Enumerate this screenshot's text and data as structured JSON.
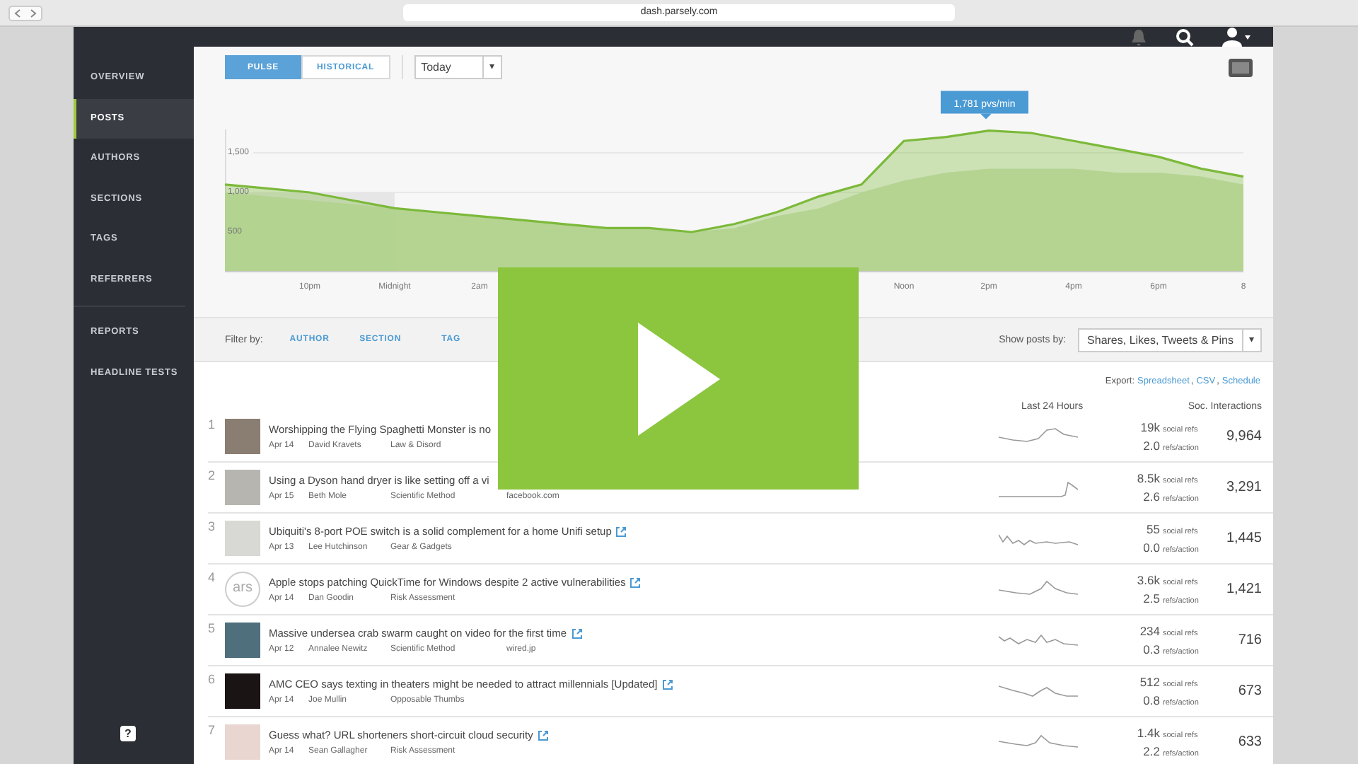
{
  "browser": {
    "url": "dash.parsely.com"
  },
  "sidebar": {
    "groups": [
      {
        "items": [
          {
            "label": "OVERVIEW",
            "selected": false
          },
          {
            "label": "POSTS",
            "selected": true
          },
          {
            "label": "AUTHORS",
            "selected": false
          },
          {
            "label": "SECTIONS",
            "selected": false
          },
          {
            "label": "TAGS",
            "selected": false
          },
          {
            "label": "REFERRERS",
            "selected": false
          }
        ]
      },
      {
        "items": [
          {
            "label": "REPORTS",
            "selected": false
          },
          {
            "label": "HEADLINE TESTS",
            "selected": false
          }
        ]
      }
    ],
    "help": "?"
  },
  "toolbar": {
    "modes": [
      {
        "label": "PULSE",
        "selected": true
      },
      {
        "label": "HISTORICAL",
        "selected": false
      }
    ],
    "period": "Today",
    "caret": "▾"
  },
  "chart": {
    "chart_data": {
      "type": "area",
      "categories": [
        null,
        null,
        "10pm",
        null,
        "Midnight",
        null,
        "2am",
        null,
        null,
        null,
        null,
        null,
        null,
        null,
        null,
        null,
        "Noon",
        null,
        "2pm",
        null,
        "4pm",
        null,
        "6pm",
        null,
        "8"
      ],
      "series": [
        {
          "color": "#7cb93a",
          "values": [
            1100,
            1050,
            1000,
            900,
            800,
            750,
            700,
            650,
            600,
            550,
            550,
            500,
            600,
            750,
            950,
            1100,
            1650,
            1700,
            1781,
            1750,
            1650,
            1550,
            1450,
            1300,
            1200
          ]
        },
        {
          "color": "#cfdfbb",
          "values": [
            1000,
            950,
            900,
            850,
            800,
            750,
            700,
            650,
            600,
            550,
            550,
            500,
            550,
            700,
            800,
            1000,
            1150,
            1250,
            1300,
            1300,
            1300,
            1250,
            1250,
            1200,
            1100
          ]
        }
      ],
      "ylim": [
        0,
        1800
      ],
      "yticks": [
        {
          "value": 500,
          "label": "500"
        },
        {
          "value": 1000,
          "label": "1,000"
        },
        {
          "value": 1500,
          "label": "1,500"
        }
      ],
      "annotations": [
        "1,781 pvs/min"
      ]
    }
  },
  "filter": {
    "label": "Filter by:",
    "options": [
      "AUTHOR",
      "SECTION",
      "TAG"
    ],
    "show_label": "Show posts by:",
    "show_value": "Shares, Likes, Tweets & Pins",
    "caret": "▾"
  },
  "export": {
    "label": "Export:",
    "items": [
      {
        "kind": "link",
        "text": "Spreadsheet"
      },
      {
        "kind": "sep",
        "text": ","
      },
      {
        "kind": "link",
        "text": "CSV"
      },
      {
        "kind": "sep",
        "text": ","
      },
      {
        "kind": "link",
        "text": "Schedule"
      }
    ]
  },
  "table": {
    "columns": [
      "Last 24 Hours",
      "Soc. Interactions"
    ],
    "rows": [
      {
        "rank": "1",
        "thumb": {
          "kind": "photo"
        },
        "title": "Worshipping the Flying Spaghetti Monster is no",
        "link": false,
        "date": "Apr 14",
        "author": "David Kravets",
        "section": "Law & Disord",
        "refs": "19k",
        "refs_label": "social refs",
        "ratio": "2.0",
        "ratio_label": "refs/action",
        "interactions": "9,964"
      },
      {
        "rank": "2",
        "thumb": {
          "kind": "photo"
        },
        "title": "Using a Dyson hand dryer is like setting off a vi",
        "link": false,
        "date": "Apr 15",
        "author": "Beth Mole",
        "section": "Scientific Method",
        "referrer": "facebook.com",
        "refs": "8.5k",
        "refs_label": "social refs",
        "ratio": "2.6",
        "ratio_label": "refs/action",
        "interactions": "3,291"
      },
      {
        "rank": "3",
        "thumb": {
          "kind": "photo"
        },
        "title": "Ubiquiti's 8-port POE switch is a solid complement for a home Unifi setup",
        "link": true,
        "date": "Apr 13",
        "author": "Lee Hutchinson",
        "section": "Gear & Gadgets",
        "refs": "55",
        "refs_label": "social refs",
        "ratio": "0.0",
        "ratio_label": "refs/action",
        "interactions": "1,445"
      },
      {
        "rank": "4",
        "thumb": {
          "kind": "logo",
          "text": "ars"
        },
        "title": "Apple stops patching QuickTime for Windows despite 2 active vulnerabilities",
        "link": true,
        "date": "Apr 14",
        "author": "Dan Goodin",
        "section": "Risk Assessment",
        "refs": "3.6k",
        "refs_label": "social refs",
        "ratio": "2.5",
        "ratio_label": "refs/action",
        "interactions": "1,421"
      },
      {
        "rank": "5",
        "thumb": {
          "kind": "photo"
        },
        "title": "Massive undersea crab swarm caught on video for the first time",
        "link": true,
        "date": "Apr 12",
        "author": "Annalee Newitz",
        "section": "Scientific Method",
        "referrer": "wired.jp",
        "refs": "234",
        "refs_label": "social refs",
        "ratio": "0.3",
        "ratio_label": "refs/action",
        "interactions": "716"
      },
      {
        "rank": "6",
        "thumb": {
          "kind": "photo"
        },
        "title": "AMC CEO says texting in theaters might be needed to attract millennials [Updated]",
        "link": true,
        "date": "Apr 14",
        "author": "Joe Mullin",
        "section": "Opposable Thumbs",
        "refs": "512",
        "refs_label": "social refs",
        "ratio": "0.8",
        "ratio_label": "refs/action",
        "interactions": "673"
      },
      {
        "rank": "7",
        "thumb": {
          "kind": "photo"
        },
        "title": "Guess what? URL shorteners short-circuit cloud security",
        "link": true,
        "date": "Apr 14",
        "author": "Sean Gallagher",
        "section": "Risk Assessment",
        "refs": "1.4k",
        "refs_label": "social refs",
        "ratio": "2.2",
        "ratio_label": "refs/action",
        "interactions": "633"
      }
    ]
  },
  "video": {
    "play": true
  }
}
